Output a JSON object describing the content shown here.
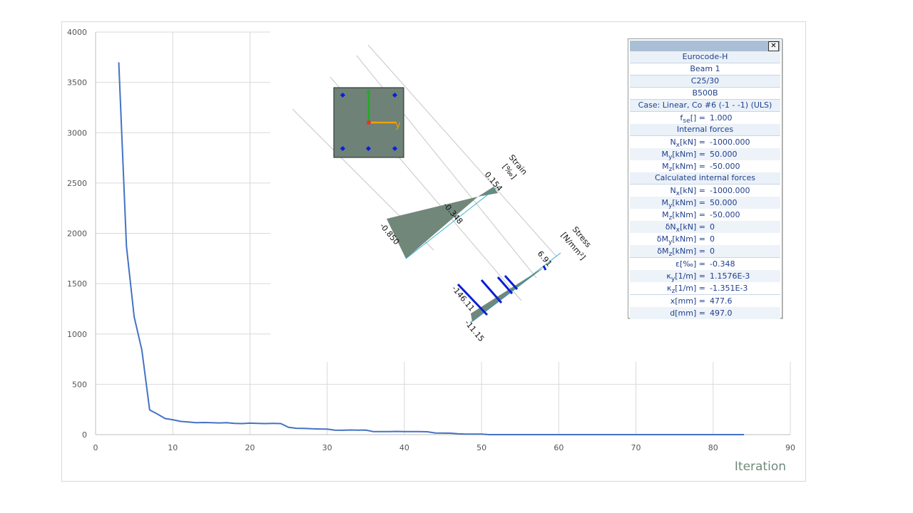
{
  "chart_data": {
    "type": "line",
    "title": "",
    "xlabel": "Iteration",
    "ylabel": "",
    "xlim": [
      0,
      90
    ],
    "ylim": [
      0,
      4000
    ],
    "xticks": [
      "0",
      "10",
      "20",
      "30",
      "40",
      "50",
      "60",
      "70",
      "80",
      "90"
    ],
    "yticks": [
      "0",
      "500",
      "1000",
      "1500",
      "2000",
      "2500",
      "3000",
      "3500",
      "4000"
    ],
    "grid": true,
    "series": [
      {
        "color": "#4472c4",
        "x": [
          3,
          4,
          5,
          6,
          7,
          8,
          9,
          10,
          11,
          12,
          13,
          14,
          15,
          16,
          17,
          18,
          19,
          20,
          21,
          22,
          23,
          24,
          25,
          26,
          27,
          28,
          29,
          30,
          31,
          32,
          33,
          34,
          35,
          36,
          37,
          38,
          39,
          40,
          41,
          42,
          43,
          44,
          45,
          46,
          47,
          48,
          49,
          50,
          51,
          52,
          53,
          54,
          55,
          56,
          57,
          58,
          59,
          60,
          61,
          62,
          63,
          64,
          65,
          66,
          67,
          68,
          69,
          70,
          71,
          72,
          73,
          74,
          75,
          76,
          77,
          78,
          79,
          80,
          81,
          82,
          83,
          84
        ],
        "y": [
          3700,
          1870,
          1170,
          840,
          245,
          205,
          160,
          148,
          132,
          125,
          118,
          120,
          118,
          116,
          118,
          112,
          110,
          114,
          112,
          110,
          112,
          110,
          72,
          63,
          62,
          58,
          56,
          55,
          44,
          43,
          46,
          44,
          45,
          30,
          30,
          30,
          32,
          30,
          30,
          30,
          28,
          16,
          15,
          14,
          8,
          6,
          6,
          5,
          0,
          0,
          0,
          0,
          0,
          0,
          0,
          0,
          0,
          0,
          0,
          0,
          0,
          0,
          0,
          0,
          0,
          0,
          0,
          0,
          0,
          0,
          0,
          0,
          0,
          0,
          0,
          0,
          0,
          0,
          0,
          0,
          0,
          0
        ]
      }
    ]
  },
  "diagram": {
    "strain_title": "Strain",
    "strain_unit": "[‰]",
    "strain_values": [
      "0.154",
      "-0.348",
      "-0.850"
    ],
    "stress_title": "Stress",
    "stress_unit": "[N/mm²]",
    "stress_values": [
      "6.91",
      "-146.11",
      "-11.15"
    ],
    "axis_y_label": "y",
    "axis_z_label": "z",
    "colors": {
      "section_fill": "#6e8277",
      "rebar": "#0a1fd4",
      "axis_y": "#f0a000",
      "axis_z": "#22aa22",
      "origin": "#e83030"
    }
  },
  "panel": {
    "code": "Eurocode-H",
    "member": "Beam 1",
    "concrete": "C25/30",
    "steel": "B500B",
    "case": "Case: Linear, Co #6 (-1 - -1) (ULS)",
    "fse": {
      "key": "f",
      "sub": "se",
      "unit": "[] =",
      "value": "1.000"
    },
    "internal_header": "Internal forces",
    "internal": [
      {
        "key": "N",
        "sub": "x",
        "unit": "[kN] =",
        "value": "-1000.000"
      },
      {
        "key": "M",
        "sub": "y",
        "unit": "[kNm] =",
        "value": "50.000"
      },
      {
        "key": "M",
        "sub": "z",
        "unit": "[kNm] =",
        "value": "-50.000"
      }
    ],
    "calc_header": "Calculated internal forces",
    "calculated": [
      {
        "key": "N",
        "sub": "x",
        "unit": "[kN] =",
        "value": "-1000.000"
      },
      {
        "key": "M",
        "sub": "y",
        "unit": "[kNm] =",
        "value": "50.000"
      },
      {
        "key": "M",
        "sub": "z",
        "unit": "[kNm] =",
        "value": "-50.000"
      },
      {
        "key": "δN",
        "sub": "x",
        "unit": "[kN] =",
        "value": "0"
      },
      {
        "key": "δM",
        "sub": "y",
        "unit": "[kNm] =",
        "value": "0"
      },
      {
        "key": "δM",
        "sub": "z",
        "unit": "[kNm] =",
        "value": "0"
      }
    ],
    "results": [
      {
        "key": "ε",
        "sub": "",
        "unit": "[‰] =",
        "value": "-0.348"
      },
      {
        "key": "κ",
        "sub": "y",
        "unit": "[1/m] =",
        "value": "1.1576E-3"
      },
      {
        "key": "κ",
        "sub": "z",
        "unit": "[1/m] =",
        "value": "-1.351E-3"
      }
    ],
    "depth": [
      {
        "key": "x",
        "sub": "",
        "unit": "[mm] =",
        "value": "477.6"
      },
      {
        "key": "d",
        "sub": "",
        "unit": "[mm] =",
        "value": "497.0"
      }
    ],
    "close_label": "✕"
  }
}
